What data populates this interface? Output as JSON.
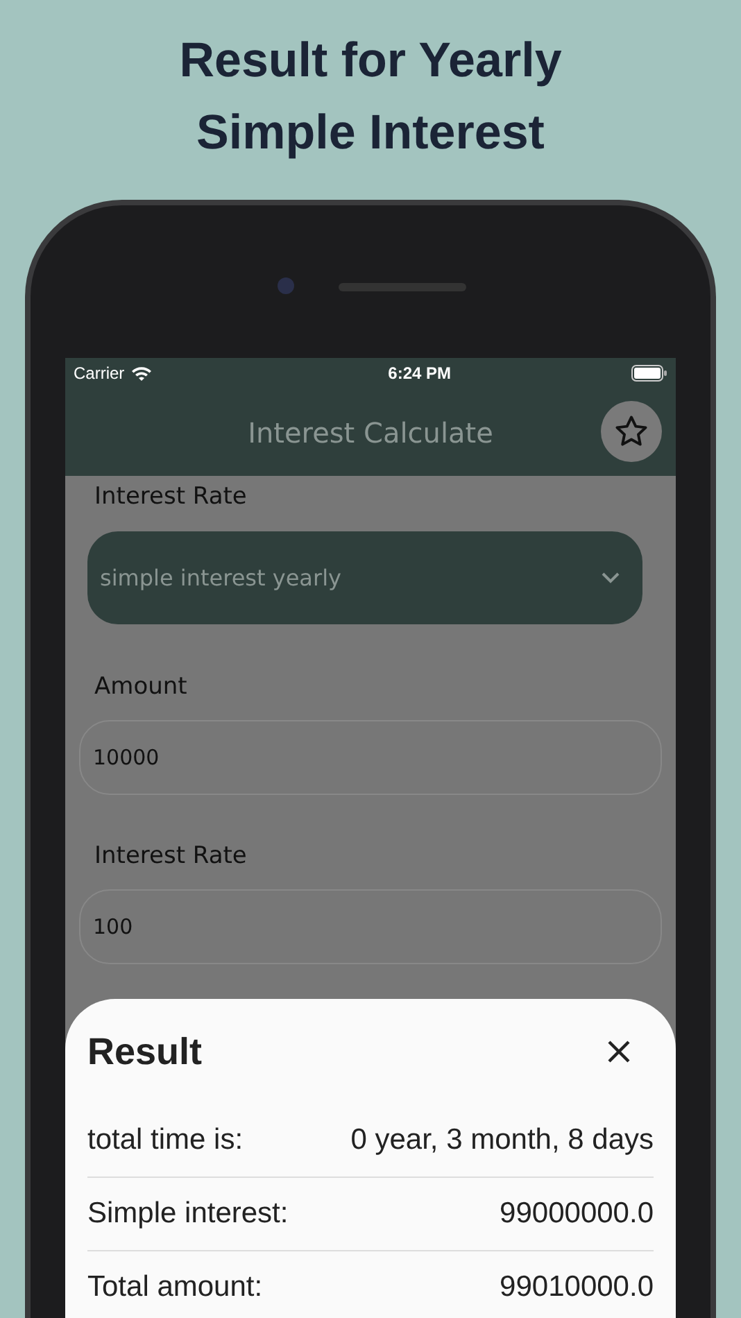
{
  "headline": "Result for Yearly Simple Interest",
  "status_bar": {
    "carrier": "Carrier",
    "time": "6:24 PM"
  },
  "app_bar": {
    "title": "Interest Calculate"
  },
  "form": [
    {
      "kind": "dropdown",
      "label": "Interest Rate",
      "value": "simple interest yearly"
    },
    {
      "kind": "input",
      "label": "Amount",
      "value": "10000"
    },
    {
      "kind": "input",
      "label": "Interest Rate",
      "value": "100"
    }
  ],
  "result_sheet": {
    "title": "Result",
    "rows": [
      {
        "label": "total time is:",
        "value": "0 year, 3 month, 8 days"
      },
      {
        "label": "Simple interest:",
        "value": "99000000.0"
      },
      {
        "label": "Total amount:",
        "value": "99010000.0"
      }
    ]
  }
}
